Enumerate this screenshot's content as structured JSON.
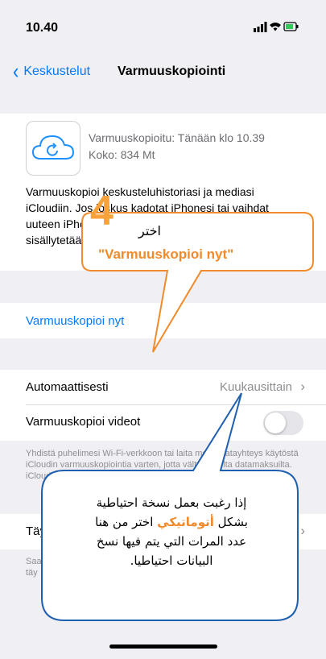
{
  "status": {
    "time": "10.40",
    "icons": "▮▮▮ ≋ ▭"
  },
  "nav": {
    "back_label": "Keskustelut",
    "title": "Varmuuskopiointi"
  },
  "backup": {
    "last_backup": "Varmuuskopioitu: Tänään klo 10.39",
    "size": "Koko: 834 Mt",
    "description": "Varmuuskopioi keskusteluhistoriasi ja mediasi iCloudiin. Jos joskus kadotat iPhonesi tai vaihdat uuteen iPhoneen, historiasi pysyy tallessa. Voit valita, sisällytetäänkö mediat, kun asetat varmuuskopion."
  },
  "actions": {
    "backup_now": "Varmuuskopioi nyt"
  },
  "settings": {
    "auto_label": "Automaattisesti",
    "auto_value": "Kuukausittain",
    "videos_label": "Varmuuskopioi videot",
    "videos_on": false,
    "footer1": "Yhdistä puhelimesi Wi-Fi-verkkoon tai laita mobiilidatayhteys käytöstä iCloudin varmuuskopiointia varten, jotta vältyt kalliilta datamaksuilta. iCloud-varmuuskopioita ei salata. Mo",
    "row3_label": "Täy",
    "footer2": "Saa täy"
  },
  "callouts": {
    "step_number": "4",
    "c1_line1": "اختر",
    "c1_line2": "\"Varmuuskopioi nyt\"",
    "c2_l1": "إذا رغبت بعمل نسخة احتياطية",
    "c2_l2_a": "بشكل ",
    "c2_l2_b": "أتوماتيكي",
    "c2_l2_c": " اختر من هنا",
    "c2_l3": "عدد المرات التي يتم فيها نسخ",
    "c2_l4": "البيانات احتياطيا."
  },
  "colors": {
    "accent": "#007aff",
    "callout_orange": "#f08a2a",
    "callout_blue": "#1f5fb0",
    "step_orange": "#f7a23a"
  }
}
